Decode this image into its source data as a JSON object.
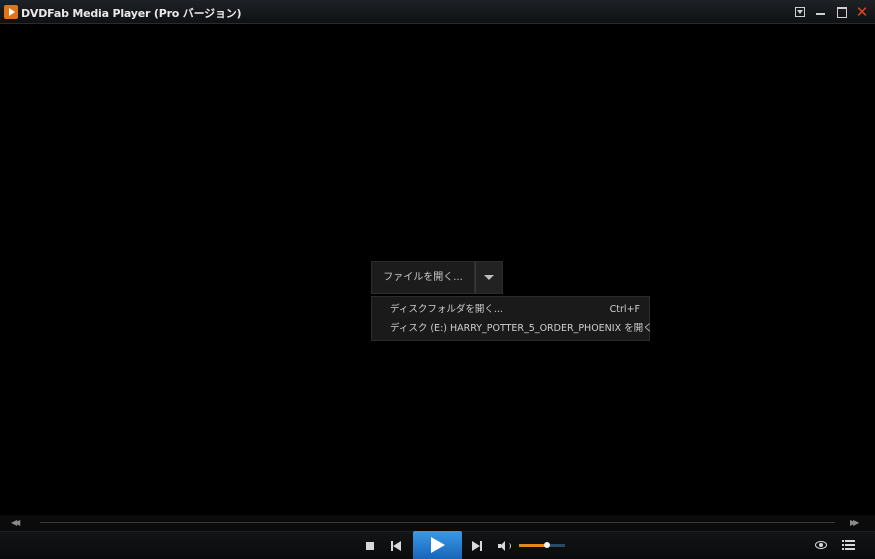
{
  "window": {
    "title": "DVDFab Media Player (Pro バージョン)",
    "controls": {
      "menu_icon": "dropdown-box-icon",
      "minimize_icon": "minimize-icon",
      "maximize_icon": "maximize-icon",
      "close_icon": "close-icon",
      "close_glyph": "✕",
      "close_color": "#e0461d"
    }
  },
  "open_menu": {
    "open_file_label": "ファイルを開く...",
    "dropdown_icon": "chevron-down-icon",
    "items": [
      {
        "label": "ディスクフォルダを開く...",
        "shortcut": "Ctrl+F"
      },
      {
        "label": "ディスク (E:) HARRY_POTTER_5_ORDER_PHOENIX を開く",
        "shortcut": ""
      }
    ]
  },
  "seek": {
    "back_icon": "rewind-icon",
    "back_glyph": "◀◀",
    "forward_icon": "fast-forward-icon",
    "forward_glyph": "▶▶",
    "position_fraction": 0
  },
  "controls": {
    "stop_icon": "stop-icon",
    "prev_icon": "skip-previous-icon",
    "play_icon": "play-icon",
    "next_icon": "skip-next-icon",
    "volume_icon": "speaker-icon",
    "volume_fraction": 0.6,
    "view_icon": "eye-icon",
    "playlist_icon": "playlist-icon"
  },
  "colors": {
    "accent_play": "#1f7ad0",
    "volume_fill": "#e08a1e",
    "app_logo": "#e07418"
  }
}
